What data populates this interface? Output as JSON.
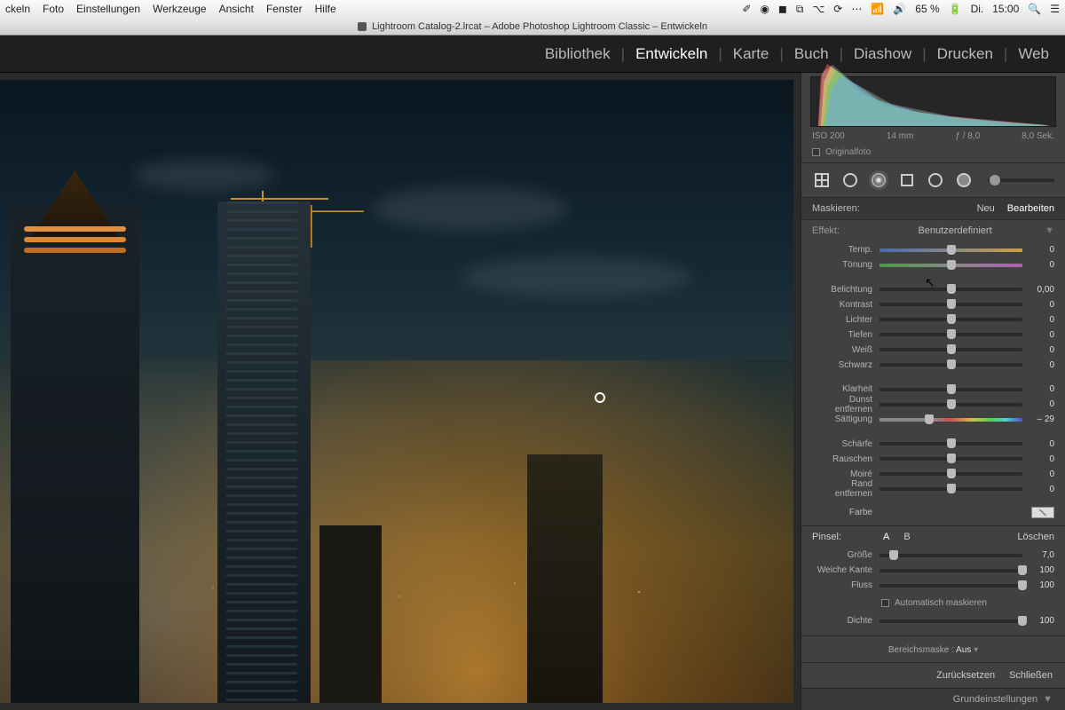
{
  "menubar": {
    "items": [
      "ckeln",
      "Foto",
      "Einstellungen",
      "Werkzeuge",
      "Ansicht",
      "Fenster",
      "Hilfe"
    ],
    "right": {
      "battery": "65 %",
      "charging_icon": "🔋",
      "day": "Di.",
      "time": "15:00"
    }
  },
  "window_title": "Lightroom Catalog-2.lrcat – Adobe Photoshop Lightroom Classic – Entwickeln",
  "modules": [
    "Bibliothek",
    "Entwickeln",
    "Karte",
    "Buch",
    "Diashow",
    "Drucken",
    "Web"
  ],
  "active_module": "Entwickeln",
  "exif": {
    "iso": "ISO 200",
    "focal": "14 mm",
    "aperture": "ƒ / 8,0",
    "shutter": "8,0 Sek."
  },
  "originalfoto_label": "Originalfoto",
  "mask": {
    "label": "Maskieren:",
    "neu": "Neu",
    "bearbeiten": "Bearbeiten"
  },
  "effect": {
    "label": "Effekt:",
    "preset": "Benutzerdefiniert"
  },
  "sliders": {
    "group1": [
      {
        "label": "Temp.",
        "value": "0",
        "pos": 50,
        "track": "temp"
      },
      {
        "label": "Tönung",
        "value": "0",
        "pos": 50,
        "track": "tint"
      }
    ],
    "group2": [
      {
        "label": "Belichtung",
        "value": "0,00",
        "pos": 50
      },
      {
        "label": "Kontrast",
        "value": "0",
        "pos": 50
      },
      {
        "label": "Lichter",
        "value": "0",
        "pos": 50
      },
      {
        "label": "Tiefen",
        "value": "0",
        "pos": 50
      },
      {
        "label": "Weiß",
        "value": "0",
        "pos": 50
      },
      {
        "label": "Schwarz",
        "value": "0",
        "pos": 50
      }
    ],
    "group3": [
      {
        "label": "Klarheit",
        "value": "0",
        "pos": 50
      },
      {
        "label": "Dunst entfernen",
        "value": "0",
        "pos": 50
      },
      {
        "label": "Sättigung",
        "value": "– 29",
        "pos": 35,
        "track": "sat"
      }
    ],
    "group4": [
      {
        "label": "Schärfe",
        "value": "0",
        "pos": 50
      },
      {
        "label": "Rauschen",
        "value": "0",
        "pos": 50
      },
      {
        "label": "Moiré",
        "value": "0",
        "pos": 50
      },
      {
        "label": "Rand entfernen",
        "value": "0",
        "pos": 50
      }
    ]
  },
  "color_label": "Farbe",
  "brush": {
    "header_label": "Pinsel:",
    "a": "A",
    "b": "B",
    "loeschen": "Löschen",
    "rows": [
      {
        "label": "Größe",
        "value": "7,0",
        "pos": 10
      },
      {
        "label": "Weiche Kante",
        "value": "100",
        "pos": 100
      },
      {
        "label": "Fluss",
        "value": "100",
        "pos": 100
      }
    ],
    "automask": "Automatisch maskieren",
    "dichte": {
      "label": "Dichte",
      "value": "100",
      "pos": 100
    }
  },
  "bereichsmaske": {
    "label": "Bereichsmaske :",
    "value": "Aus"
  },
  "actions": {
    "reset": "Zurücksetzen",
    "close": "Schließen"
  },
  "grund_label": "Grundeinstellungen"
}
